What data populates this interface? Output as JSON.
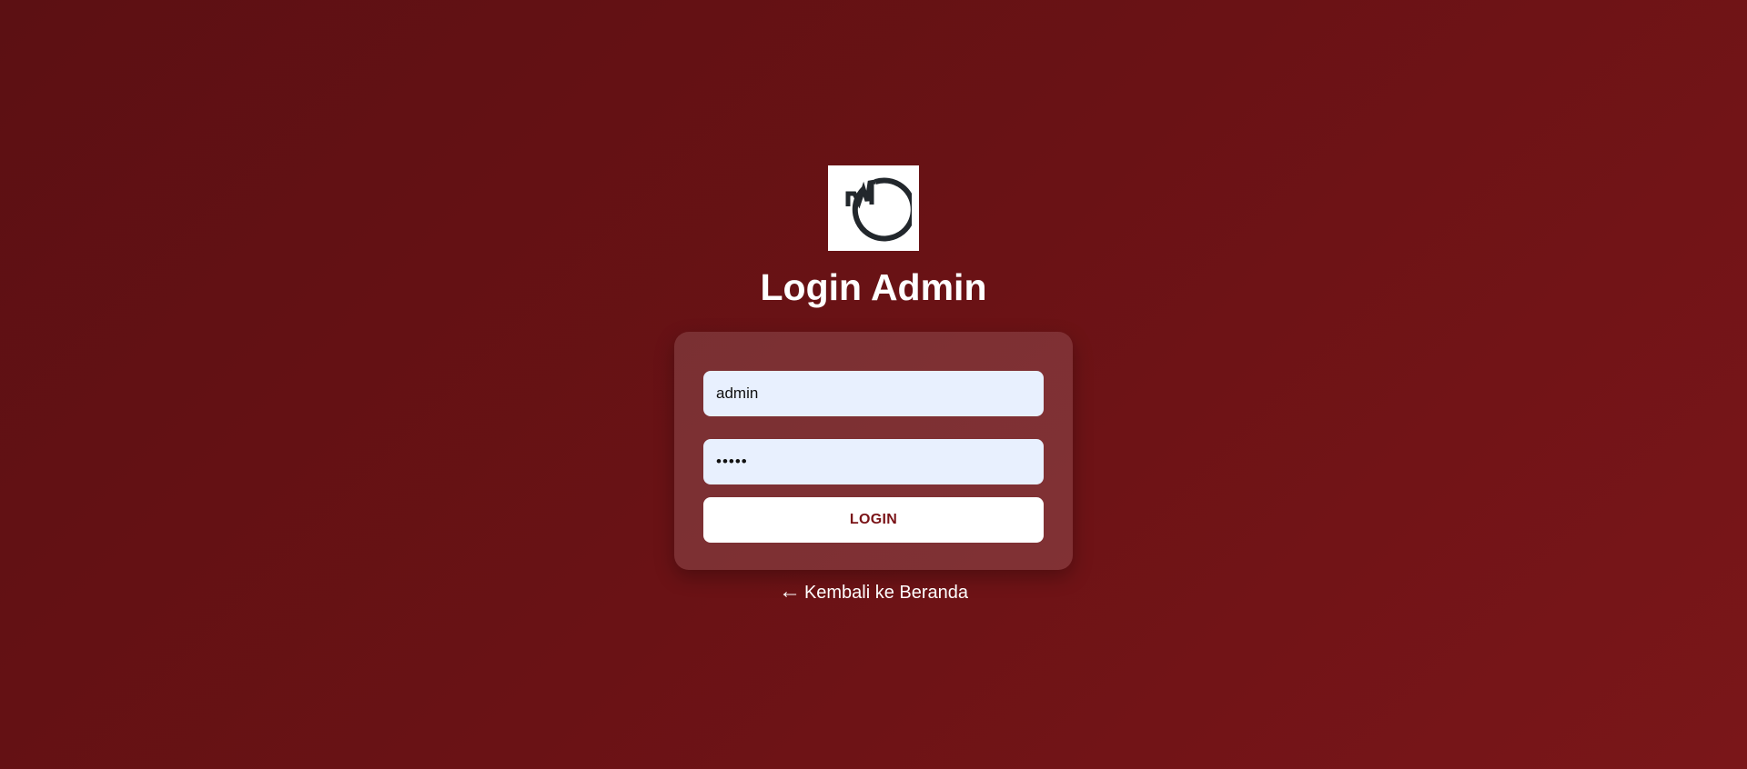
{
  "logo": {
    "icon": "md-circle-logo",
    "text": "MD"
  },
  "page_title": "Login Admin",
  "form": {
    "username": {
      "value": "admin"
    },
    "password": {
      "value": "•••••"
    },
    "submit_label": "LOGIN"
  },
  "back_link": {
    "arrow": "←",
    "label": "Kembali ke Beranda"
  },
  "colors": {
    "background": "#6a1215",
    "accent": "#7a1317",
    "input_background": "#e8f0fe"
  }
}
